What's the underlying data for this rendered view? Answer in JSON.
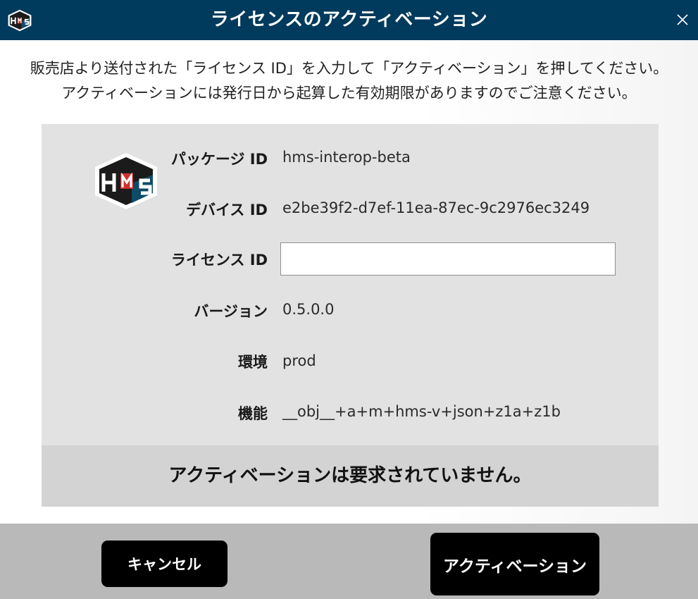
{
  "window": {
    "title": "ライセンスのアクティベーション",
    "app_icon": "hms-logo-icon",
    "close_icon": "close-icon",
    "colors": {
      "titlebar": "#003a5c",
      "panel": "#e2e2e2",
      "status_strip": "#d3d3d3",
      "footer": "#b9b9b9",
      "button": "#000000",
      "logo_dark": "#1b1b1b",
      "logo_red": "#d0312d",
      "logo_teal": "#0f4a66"
    }
  },
  "instructions": {
    "line1": "販売店より送付された「ライセンス ID」を入力して「アクティベーション」を押してください。",
    "line2": "アクティベーションには発行日から起算した有効期限がありますのでご注意ください。"
  },
  "info": {
    "logo_icon": "hms-logo-icon",
    "package_label": "パッケージ ID",
    "package_value": "hms-interop-beta",
    "device_label": "デバイス ID",
    "device_value": "e2be39f2-d7ef-11ea-87ec-9c2976ec3249",
    "license_label": "ライセンス ID",
    "license_value": "",
    "license_placeholder": "",
    "version_label": "バージョン",
    "version_value": "0.5.0.0",
    "env_label": "環境",
    "env_value": "prod",
    "features_label": "機能",
    "features_value": "__obj__+a+m+hms-v+json+z1a+z1b"
  },
  "status": {
    "text": "アクティベーションは要求されていません。"
  },
  "footer": {
    "cancel_label": "キャンセル",
    "activate_label": "アクティベーション"
  }
}
